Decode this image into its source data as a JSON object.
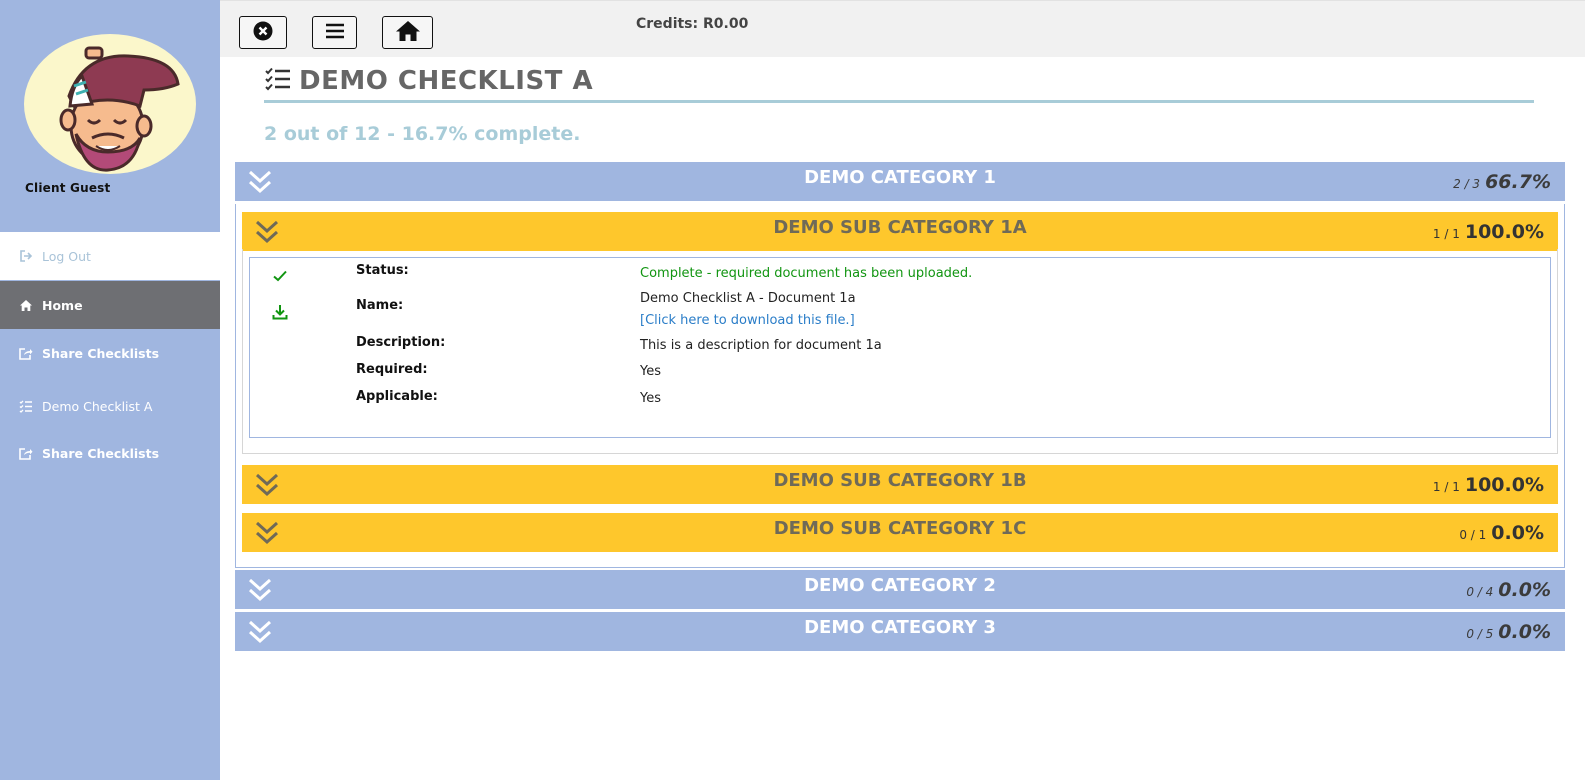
{
  "user": {
    "name": "Client Guest"
  },
  "sidebar": {
    "items": [
      {
        "label": "Log Out",
        "icon": "sign-out-icon"
      },
      {
        "label": "Home",
        "icon": "home-icon"
      },
      {
        "label": "Share Checklists",
        "icon": "share-icon"
      },
      {
        "label": "Demo Checklist A",
        "icon": "checklist-icon"
      },
      {
        "label": "Share Checklists",
        "icon": "share-icon"
      }
    ]
  },
  "topbar": {
    "credits": "Credits: R0.00",
    "buttons": [
      "close-icon",
      "menu-icon",
      "home-icon"
    ]
  },
  "page": {
    "title": "DEMO CHECKLIST A",
    "progress": "2 out of 12 - 16.7% complete."
  },
  "categories": [
    {
      "title": "DEMO CATEGORY 1",
      "fraction": "2 / 3",
      "percent": "66.7%",
      "subcategories": [
        {
          "title": "DEMO SUB CATEGORY 1A",
          "fraction": "1 / 1",
          "percent": "100.0%",
          "document": {
            "status_label": "Status:",
            "status": "Complete - required document has been uploaded.",
            "name_label": "Name:",
            "name": "Demo Checklist A - Document 1a",
            "download_link": "[Click here to download this file.]",
            "description_label": "Description:",
            "description": "This is a description for document 1a",
            "required_label": "Required:",
            "required": "Yes",
            "applicable_label": "Applicable:",
            "applicable": "Yes"
          }
        },
        {
          "title": "DEMO SUB CATEGORY 1B",
          "fraction": "1 / 1",
          "percent": "100.0%"
        },
        {
          "title": "DEMO SUB CATEGORY 1C",
          "fraction": "0 / 1",
          "percent": "0.0%"
        }
      ]
    },
    {
      "title": "DEMO CATEGORY 2",
      "fraction": "0 / 4",
      "percent": "0.0%"
    },
    {
      "title": "DEMO CATEGORY 3",
      "fraction": "0 / 5",
      "percent": "0.0%"
    }
  ],
  "colors": {
    "sidebar": "#a0b6e0",
    "category_bar": "#a0b6e0",
    "subcategory_bar": "#fec72c",
    "active_nav": "#6e6f73",
    "progress_text": "#a8ccd8",
    "status_complete": "#119511",
    "link": "#2a7dc8"
  }
}
